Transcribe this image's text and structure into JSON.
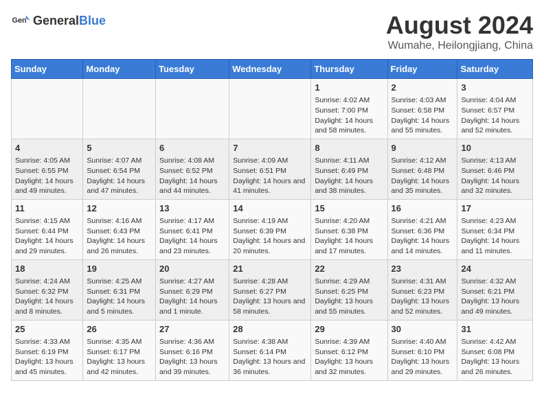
{
  "logo": {
    "general": "General",
    "blue": "Blue"
  },
  "title": "August 2024",
  "subtitle": "Wumahe, Heilongjiang, China",
  "headers": [
    "Sunday",
    "Monday",
    "Tuesday",
    "Wednesday",
    "Thursday",
    "Friday",
    "Saturday"
  ],
  "weeks": [
    [
      {
        "day": "",
        "content": ""
      },
      {
        "day": "",
        "content": ""
      },
      {
        "day": "",
        "content": ""
      },
      {
        "day": "",
        "content": ""
      },
      {
        "day": "1",
        "content": "Sunrise: 4:02 AM\nSunset: 7:00 PM\nDaylight: 14 hours and 58 minutes."
      },
      {
        "day": "2",
        "content": "Sunrise: 4:03 AM\nSunset: 6:58 PM\nDaylight: 14 hours and 55 minutes."
      },
      {
        "day": "3",
        "content": "Sunrise: 4:04 AM\nSunset: 6:57 PM\nDaylight: 14 hours and 52 minutes."
      }
    ],
    [
      {
        "day": "4",
        "content": "Sunrise: 4:05 AM\nSunset: 6:55 PM\nDaylight: 14 hours and 49 minutes."
      },
      {
        "day": "5",
        "content": "Sunrise: 4:07 AM\nSunset: 6:54 PM\nDaylight: 14 hours and 47 minutes."
      },
      {
        "day": "6",
        "content": "Sunrise: 4:08 AM\nSunset: 6:52 PM\nDaylight: 14 hours and 44 minutes."
      },
      {
        "day": "7",
        "content": "Sunrise: 4:09 AM\nSunset: 6:51 PM\nDaylight: 14 hours and 41 minutes."
      },
      {
        "day": "8",
        "content": "Sunrise: 4:11 AM\nSunset: 6:49 PM\nDaylight: 14 hours and 38 minutes."
      },
      {
        "day": "9",
        "content": "Sunrise: 4:12 AM\nSunset: 6:48 PM\nDaylight: 14 hours and 35 minutes."
      },
      {
        "day": "10",
        "content": "Sunrise: 4:13 AM\nSunset: 6:46 PM\nDaylight: 14 hours and 32 minutes."
      }
    ],
    [
      {
        "day": "11",
        "content": "Sunrise: 4:15 AM\nSunset: 6:44 PM\nDaylight: 14 hours and 29 minutes."
      },
      {
        "day": "12",
        "content": "Sunrise: 4:16 AM\nSunset: 6:43 PM\nDaylight: 14 hours and 26 minutes."
      },
      {
        "day": "13",
        "content": "Sunrise: 4:17 AM\nSunset: 6:41 PM\nDaylight: 14 hours and 23 minutes."
      },
      {
        "day": "14",
        "content": "Sunrise: 4:19 AM\nSunset: 6:39 PM\nDaylight: 14 hours and 20 minutes."
      },
      {
        "day": "15",
        "content": "Sunrise: 4:20 AM\nSunset: 6:38 PM\nDaylight: 14 hours and 17 minutes."
      },
      {
        "day": "16",
        "content": "Sunrise: 4:21 AM\nSunset: 6:36 PM\nDaylight: 14 hours and 14 minutes."
      },
      {
        "day": "17",
        "content": "Sunrise: 4:23 AM\nSunset: 6:34 PM\nDaylight: 14 hours and 11 minutes."
      }
    ],
    [
      {
        "day": "18",
        "content": "Sunrise: 4:24 AM\nSunset: 6:32 PM\nDaylight: 14 hours and 8 minutes."
      },
      {
        "day": "19",
        "content": "Sunrise: 4:25 AM\nSunset: 6:31 PM\nDaylight: 14 hours and 5 minutes."
      },
      {
        "day": "20",
        "content": "Sunrise: 4:27 AM\nSunset: 6:29 PM\nDaylight: 14 hours and 1 minute."
      },
      {
        "day": "21",
        "content": "Sunrise: 4:28 AM\nSunset: 6:27 PM\nDaylight: 13 hours and 58 minutes."
      },
      {
        "day": "22",
        "content": "Sunrise: 4:29 AM\nSunset: 6:25 PM\nDaylight: 13 hours and 55 minutes."
      },
      {
        "day": "23",
        "content": "Sunrise: 4:31 AM\nSunset: 6:23 PM\nDaylight: 13 hours and 52 minutes."
      },
      {
        "day": "24",
        "content": "Sunrise: 4:32 AM\nSunset: 6:21 PM\nDaylight: 13 hours and 49 minutes."
      }
    ],
    [
      {
        "day": "25",
        "content": "Sunrise: 4:33 AM\nSunset: 6:19 PM\nDaylight: 13 hours and 45 minutes."
      },
      {
        "day": "26",
        "content": "Sunrise: 4:35 AM\nSunset: 6:17 PM\nDaylight: 13 hours and 42 minutes."
      },
      {
        "day": "27",
        "content": "Sunrise: 4:36 AM\nSunset: 6:16 PM\nDaylight: 13 hours and 39 minutes."
      },
      {
        "day": "28",
        "content": "Sunrise: 4:38 AM\nSunset: 6:14 PM\nDaylight: 13 hours and 36 minutes."
      },
      {
        "day": "29",
        "content": "Sunrise: 4:39 AM\nSunset: 6:12 PM\nDaylight: 13 hours and 32 minutes."
      },
      {
        "day": "30",
        "content": "Sunrise: 4:40 AM\nSunset: 6:10 PM\nDaylight: 13 hours and 29 minutes."
      },
      {
        "day": "31",
        "content": "Sunrise: 4:42 AM\nSunset: 6:08 PM\nDaylight: 13 hours and 26 minutes."
      }
    ]
  ]
}
